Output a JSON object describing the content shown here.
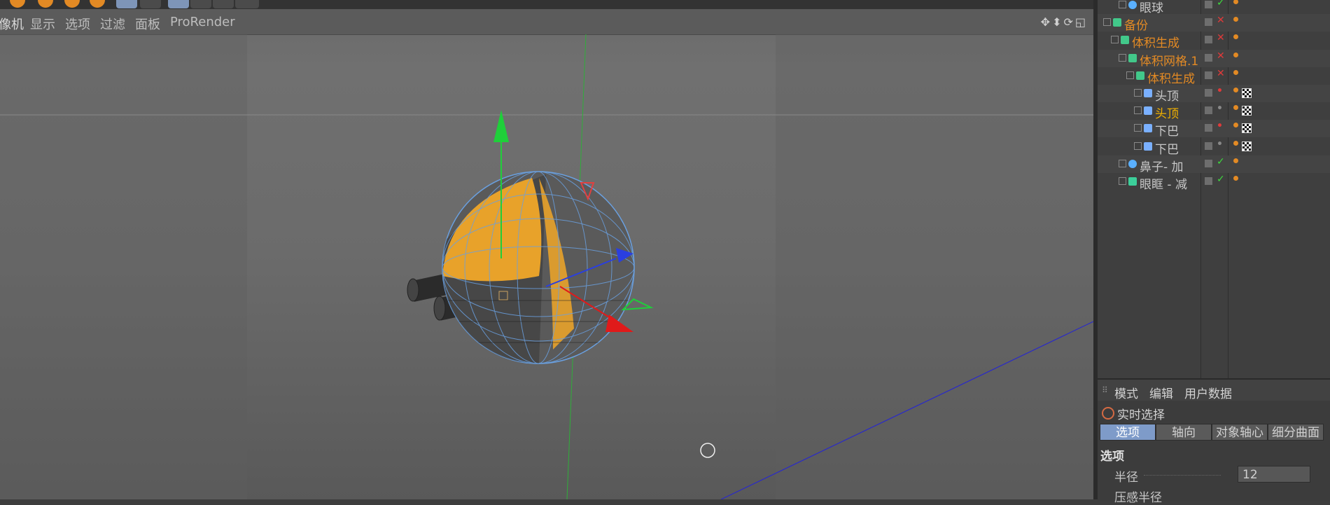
{
  "viewport": {
    "menu": [
      "像机",
      "显示",
      "选项",
      "过滤",
      "面板",
      "ProRender"
    ],
    "nav_icons": "✥⬍⟳◱"
  },
  "object_manager": {
    "rows": [
      {
        "name": "眼球",
        "indent": 2,
        "color": "#c8c8c8",
        "icon": "sphere-icon",
        "status": "check"
      },
      {
        "name": "备份",
        "indent": 0,
        "color": "#e38a24",
        "icon": "volume-builder-icon",
        "status": "x"
      },
      {
        "name": "体积生成",
        "indent": 1,
        "color": "#e38a24",
        "icon": "volume-builder-icon",
        "status": "x"
      },
      {
        "name": "体积网格.1",
        "indent": 2,
        "color": "#e38a24",
        "icon": "volume-mesher-icon",
        "status": "x"
      },
      {
        "name": "体积生成",
        "indent": 3,
        "color": "#e38a24",
        "icon": "volume-builder-icon",
        "status": "x"
      },
      {
        "name": "头顶",
        "indent": 4,
        "color": "#c8c8c8",
        "icon": "joint-icon",
        "status": "dot-red"
      },
      {
        "name": "头顶",
        "indent": 4,
        "color": "#f0b000",
        "icon": "joint-icon",
        "status": "dot"
      },
      {
        "name": "下巴",
        "indent": 4,
        "color": "#c8c8c8",
        "icon": "joint-icon",
        "status": "dot-red"
      },
      {
        "name": "下巴",
        "indent": 4,
        "color": "#c8c8c8",
        "icon": "joint-icon",
        "status": "dot"
      },
      {
        "name": "鼻子- 加",
        "indent": 2,
        "color": "#c8c8c8",
        "icon": "sphere-icon",
        "status": "check"
      },
      {
        "name": "眼眶 - 减",
        "indent": 2,
        "color": "#c8c8c8",
        "icon": "cube-icon",
        "status": "check"
      }
    ]
  },
  "attributes": {
    "menu": [
      "模式",
      "编辑",
      "用户数据"
    ],
    "tool_title": "实时选择",
    "tabs": [
      "选项",
      "轴向",
      "对象轴心",
      "细分曲面"
    ],
    "active_tab": "选项",
    "section_title": "选项",
    "radius_label": "半径",
    "radius_value": "12",
    "pressure_label": "压感半径"
  },
  "colors": {
    "accent_orange": "#e38a24",
    "active_tab_blue": "#7e9bc9",
    "axis_green": "#1fcf3a",
    "axis_red": "#e01a1a",
    "axis_blue": "#2a3fe0"
  }
}
